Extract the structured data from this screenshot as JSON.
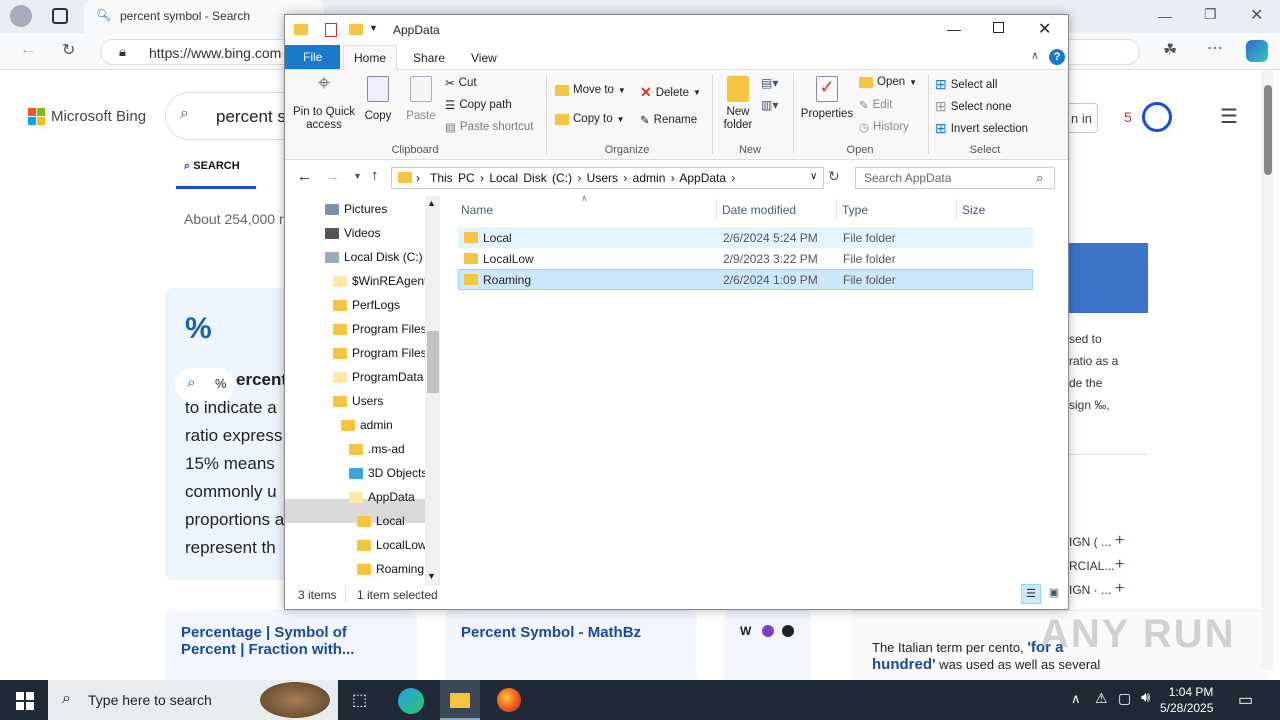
{
  "browser": {
    "tab_title": "percent symbol - Search",
    "url": "https://www.bing.com"
  },
  "bing": {
    "logo": "Microsoft Bing",
    "query": "percent sy",
    "tab_search": "SEARCH",
    "about": "About 254,000 r",
    "card_symbol": "%",
    "lens_label": "%",
    "card_heading": "ercent",
    "card_lines": [
      "to indicate a",
      "ratio express",
      "15% means",
      "commonly u",
      "proportions a",
      "represent th"
    ],
    "result_cards": [
      "Percentage | Symbol of Percent | Fraction with...",
      "Percent Symbol - MathBz"
    ],
    "right_text": [
      "sed to",
      "ratio as a",
      "de the",
      "sign ‰,"
    ],
    "right_links": [
      "IGN ( ...",
      "RCIAL...",
      "IGN · ..."
    ],
    "right_bottom_a": "The Italian term per cento, ",
    "right_bottom_b": "'for a",
    "right_bottom_c": "hundred'",
    "right_bottom_d": " was used as well as several",
    "signin": "n in",
    "rewards_count": "5"
  },
  "explorer": {
    "title": "AppData",
    "menu": {
      "file": "File",
      "home": "Home",
      "share": "Share",
      "view": "View"
    },
    "ribbon": {
      "pin": "Pin to Quick access",
      "copy": "Copy",
      "paste": "Paste",
      "cut": "Cut",
      "copy_path": "Copy path",
      "paste_shortcut": "Paste shortcut",
      "clipboard": "Clipboard",
      "move_to": "Move to",
      "copy_to": "Copy to",
      "delete": "Delete",
      "rename": "Rename",
      "organize": "Organize",
      "new_folder": "New folder",
      "new": "New",
      "properties": "Properties",
      "open": "Open",
      "edit": "Edit",
      "history": "History",
      "open_group": "Open",
      "select_all": "Select all",
      "select_none": "Select none",
      "invert": "Invert selection",
      "select": "Select"
    },
    "address": "This PC  ›  Local Disk (C:)  ›  Users  ›  admin  ›  AppData  ›",
    "search_placeholder": "Search AppData",
    "tree": [
      "Pictures",
      "Videos",
      "Local Disk (C:)",
      "$WinREAgent",
      "PerfLogs",
      "Program Files",
      "Program Files",
      "ProgramData",
      "Users",
      "admin",
      ".ms-ad",
      "3D Objects",
      "AppData",
      "Local",
      "LocalLow",
      "Roaming"
    ],
    "columns": [
      "Name",
      "Date modified",
      "Type",
      "Size"
    ],
    "rows": [
      {
        "name": "Local",
        "date": "2/6/2024 5:24 PM",
        "type": "File folder"
      },
      {
        "name": "LocalLow",
        "date": "2/9/2023 3:22 PM",
        "type": "File folder"
      },
      {
        "name": "Roaming",
        "date": "2/6/2024 1:09 PM",
        "type": "File folder"
      }
    ],
    "status_items": "3 items",
    "status_selected": "1 item selected"
  },
  "taskbar": {
    "search_placeholder": "Type here to search",
    "time": "1:04 PM",
    "date": "5/28/2025"
  },
  "watermark": "ANY RUN",
  "colors": {
    "accent": "#1a73e8",
    "selection": "#cce8ff",
    "file_tab": "#1979ca",
    "taskbar": "#1f2a36"
  }
}
